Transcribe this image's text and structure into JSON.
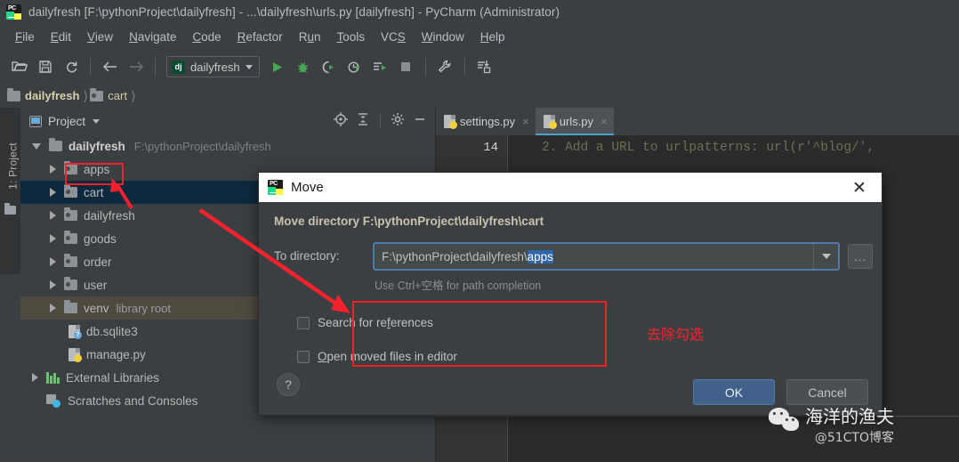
{
  "window": {
    "title": "dailyfresh [F:\\pythonProject\\dailyfresh] - ...\\dailyfresh\\urls.py [dailyfresh] - PyCharm (Administrator)",
    "app_icon": "pycharm-icon"
  },
  "menubar": {
    "items": [
      {
        "label": "File",
        "mnemonic": "F"
      },
      {
        "label": "Edit",
        "mnemonic": "E"
      },
      {
        "label": "View",
        "mnemonic": "V"
      },
      {
        "label": "Navigate",
        "mnemonic": "N"
      },
      {
        "label": "Code",
        "mnemonic": "C"
      },
      {
        "label": "Refactor",
        "mnemonic": "R"
      },
      {
        "label": "Run",
        "mnemonic": "u"
      },
      {
        "label": "Tools",
        "mnemonic": "T"
      },
      {
        "label": "VCS",
        "mnemonic": "S"
      },
      {
        "label": "Window",
        "mnemonic": "W"
      },
      {
        "label": "Help",
        "mnemonic": "H"
      }
    ]
  },
  "toolbar": {
    "buttons": [
      {
        "name": "open-folder-icon",
        "glyph": "open-folder"
      },
      {
        "name": "save-all-icon",
        "glyph": "save"
      },
      {
        "name": "sync-refresh-icon",
        "glyph": "refresh"
      },
      {
        "name": "back-icon",
        "glyph": "arrow-left"
      },
      {
        "name": "forward-icon",
        "glyph": "arrow-right"
      }
    ],
    "run_config": {
      "label": "dailyfresh",
      "icon": "dj-icon",
      "icon_text": "dj"
    },
    "run_buttons": [
      {
        "name": "run-icon",
        "glyph": "play"
      },
      {
        "name": "debug-icon",
        "glyph": "bug"
      },
      {
        "name": "run-with-coverage-icon",
        "glyph": "coverage"
      },
      {
        "name": "profile-icon",
        "glyph": "profiler"
      },
      {
        "name": "run-tool-icon",
        "glyph": "run-list"
      },
      {
        "name": "stop-icon",
        "glyph": "square"
      }
    ],
    "right_buttons": [
      {
        "name": "settings-wrench-icon",
        "glyph": "wrench"
      },
      {
        "name": "update-project-icon",
        "glyph": "update"
      }
    ]
  },
  "breadcrumb": {
    "items": [
      {
        "label": "dailyfresh",
        "icon": "folder-icon",
        "bold": true
      },
      {
        "label": "cart",
        "icon": "module-folder-icon",
        "bold": false
      }
    ]
  },
  "toolwindow_strip": {
    "label": "1: Project",
    "icon": "folder-icon"
  },
  "project_panel": {
    "title": "Project",
    "title_icon": "project-icon",
    "tools": [
      {
        "name": "scroll-from-source-icon",
        "glyph": "target"
      },
      {
        "name": "collapse-all-icon",
        "glyph": "collapse"
      },
      {
        "name": "settings-gear-icon",
        "glyph": "gear"
      },
      {
        "name": "hide-panel-icon",
        "glyph": "minus"
      }
    ],
    "tree": [
      {
        "label": "dailyfresh",
        "suffix": "F:\\pythonProject\\dailyfresh",
        "icon": "folder-icon",
        "indent": 0,
        "expanded": true,
        "bold": true,
        "selected": "none"
      },
      {
        "label": "apps",
        "suffix": "",
        "icon": "module-folder-icon",
        "indent": 1,
        "expanded": false,
        "bold": false,
        "selected": "none"
      },
      {
        "label": "cart",
        "suffix": "",
        "icon": "module-folder-icon",
        "indent": 1,
        "expanded": false,
        "bold": false,
        "selected": "blue"
      },
      {
        "label": "dailyfresh",
        "suffix": "",
        "icon": "module-folder-icon",
        "indent": 1,
        "expanded": false,
        "bold": false,
        "selected": "none"
      },
      {
        "label": "goods",
        "suffix": "",
        "icon": "module-folder-icon",
        "indent": 1,
        "expanded": false,
        "bold": false,
        "selected": "none"
      },
      {
        "label": "order",
        "suffix": "",
        "icon": "module-folder-icon",
        "indent": 1,
        "expanded": false,
        "bold": false,
        "selected": "none"
      },
      {
        "label": "user",
        "suffix": "",
        "icon": "module-folder-icon",
        "indent": 1,
        "expanded": false,
        "bold": false,
        "selected": "none"
      },
      {
        "label": "venv",
        "suffix": "library root",
        "icon": "folder-icon",
        "indent": 1,
        "expanded": false,
        "bold": false,
        "selected": "grey"
      },
      {
        "label": "db.sqlite3",
        "suffix": "",
        "icon": "unknown-file-icon",
        "indent": 2,
        "expanded": null,
        "bold": false,
        "selected": "none"
      },
      {
        "label": "manage.py",
        "suffix": "",
        "icon": "python-file-icon",
        "indent": 2,
        "expanded": null,
        "bold": false,
        "selected": "none"
      },
      {
        "label": "External Libraries",
        "suffix": "",
        "icon": "libraries-icon",
        "indent": 0,
        "expanded": false,
        "bold": false,
        "selected": "none"
      },
      {
        "label": "Scratches and Consoles",
        "suffix": "",
        "icon": "scratches-icon",
        "indent": 0,
        "expanded": null,
        "bold": false,
        "selected": "none"
      }
    ]
  },
  "editor": {
    "tabs": [
      {
        "label": "settings.py",
        "icon": "python-file-icon",
        "active": false,
        "close": "×"
      },
      {
        "label": "urls.py",
        "icon": "python-file-icon",
        "active": true,
        "close": "×"
      }
    ],
    "line_number": "14",
    "code_line": "2. Add a URL to urlpatterns:  url(r'^blog/',"
  },
  "dialog": {
    "title": "Move",
    "title_icon": "pycharm-icon",
    "close_glyph": "✕",
    "heading": "Move directory F:\\pythonProject\\dailyfresh\\cart",
    "to_directory_label": "To directory:",
    "path_prefix": "F:\\pythonProject\\dailyfresh\\",
    "path_selected": "apps",
    "dropdown_icon": "chevron-down-icon",
    "browse_label": "...",
    "hint": "Use Ctrl+空格 for path completion",
    "checkboxes": [
      {
        "label_pre": "Search for re",
        "label_uk": "f",
        "label_post": "erences",
        "checked": false,
        "name": "search-for-references-checkbox"
      },
      {
        "label_pre": "",
        "label_uk": "O",
        "label_post": "pen moved files in editor",
        "checked": false,
        "name": "open-moved-files-checkbox"
      }
    ],
    "help_label": "?",
    "ok_label": "OK",
    "cancel_label": "Cancel"
  },
  "annotations": {
    "callout_text": "去除勾选",
    "accent_color": "#f5222d",
    "boxes": [
      {
        "name": "apps-highlight-box"
      },
      {
        "name": "checkboxes-highlight-box"
      }
    ],
    "arrows": [
      {
        "name": "arrow-to-apps"
      },
      {
        "name": "arrow-to-checkboxes"
      }
    ]
  },
  "watermark": {
    "icon": "wechat-icon",
    "name": "海洋的渔夫",
    "handle": "@51CTO博客"
  }
}
